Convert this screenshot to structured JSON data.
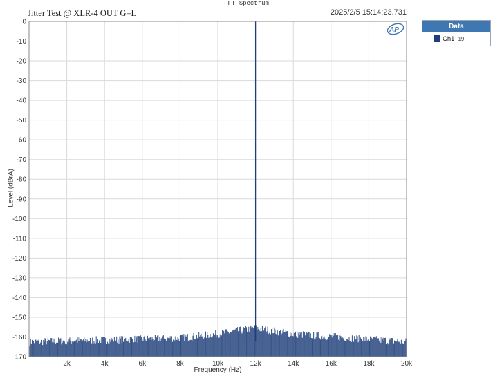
{
  "window": {
    "title": "FFT Spectrum"
  },
  "header": {
    "chart_title": "Jitter Test @ XLR-4 OUT  G=L",
    "timestamp": "2025/2/5 15:14:23.731",
    "logo_text": "AP"
  },
  "legend": {
    "header": "Data",
    "items": [
      {
        "label": "Ch1",
        "number": "19",
        "color": "#1f3f7a"
      }
    ]
  },
  "chart_data": {
    "type": "line",
    "title": "Jitter Test @ XLR-4 OUT  G=L",
    "xlabel": "Frequency (Hz)",
    "ylabel": "Level (dBrA)",
    "xlim": [
      0,
      20000
    ],
    "ylim": [
      -170,
      0
    ],
    "x_ticks": [
      2000,
      4000,
      6000,
      8000,
      10000,
      12000,
      14000,
      16000,
      18000,
      20000
    ],
    "x_tick_labels": [
      "2k",
      "4k",
      "6k",
      "8k",
      "10k",
      "12k",
      "14k",
      "16k",
      "18k",
      "20k"
    ],
    "y_ticks": [
      0,
      -10,
      -20,
      -30,
      -40,
      -50,
      -60,
      -70,
      -80,
      -90,
      -100,
      -110,
      -120,
      -130,
      -140,
      -150,
      -160,
      -170
    ],
    "y_tick_labels": [
      "0",
      "-10",
      "-20",
      "-30",
      "-40",
      "-50",
      "-60",
      "-70",
      "-80",
      "-90",
      "-100",
      "-110",
      "-120",
      "-130",
      "-140",
      "-150",
      "-160",
      "-170"
    ],
    "grid": true,
    "legend_position": "right",
    "series": [
      {
        "name": "Ch1",
        "color": "#1f3f7a",
        "peak": {
          "x": 12000,
          "y": 0
        },
        "noise_floor_db": -162,
        "noise_floor_profile": [
          {
            "x": 0,
            "y": -162
          },
          {
            "x": 8000,
            "y": -160
          },
          {
            "x": 10000,
            "y": -158
          },
          {
            "x": 12000,
            "y": -155
          },
          {
            "x": 14000,
            "y": -158
          },
          {
            "x": 17000,
            "y": -160
          },
          {
            "x": 20000,
            "y": -162
          }
        ]
      }
    ]
  }
}
